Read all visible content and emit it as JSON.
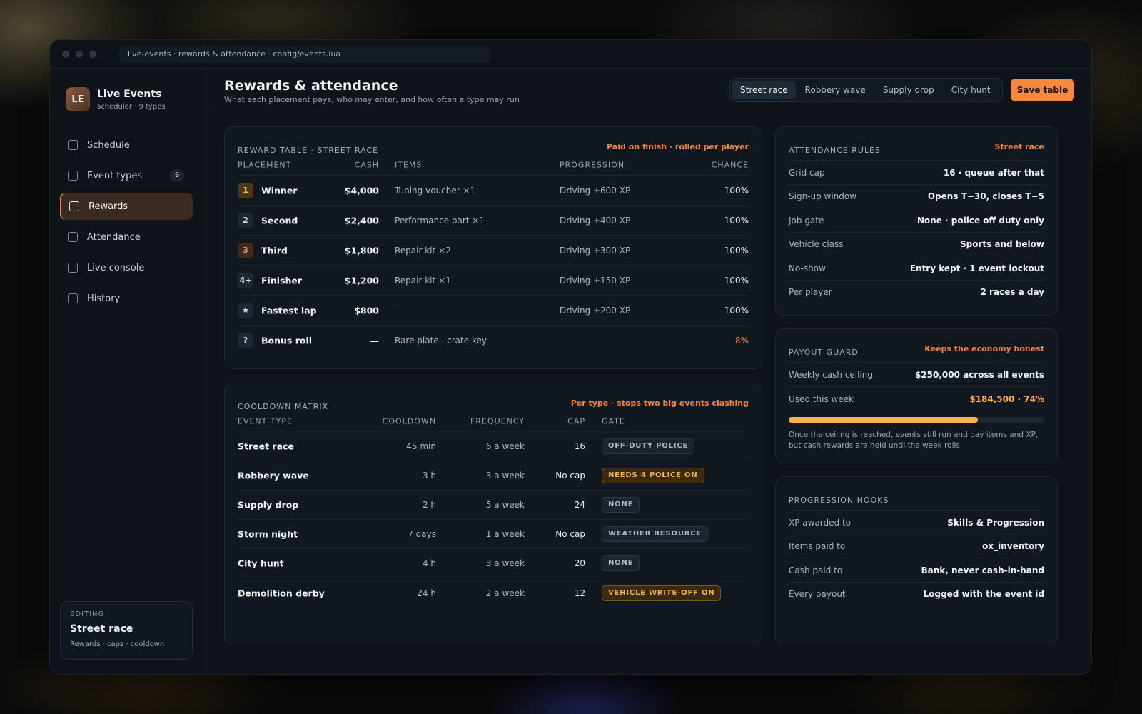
{
  "window": {
    "url": "live-events · rewards & attendance · config/events.lua"
  },
  "sidebar": {
    "brand_initials": "LE",
    "brand_name": "Live Events",
    "brand_sub": "scheduler · 9 types",
    "items": [
      {
        "label": "Schedule"
      },
      {
        "label": "Event types",
        "count": "9"
      },
      {
        "label": "Rewards"
      },
      {
        "label": "Attendance"
      },
      {
        "label": "Live console"
      },
      {
        "label": "History"
      }
    ],
    "editing": {
      "kicker": "EDITING",
      "value": "Street race",
      "sub": "Rewards · caps · cooldown"
    }
  },
  "header": {
    "title": "Rewards & attendance",
    "subtitle": "What each placement pays, who may enter, and how often a type may run",
    "tabs": [
      "Street race",
      "Robbery wave",
      "Supply drop",
      "City hunt"
    ],
    "save_label": "Save table"
  },
  "reward_table": {
    "title": "REWARD TABLE · STREET RACE",
    "note": "Paid on finish · rolled per player",
    "columns": [
      "PLACEMENT",
      "CASH",
      "ITEMS",
      "PROGRESSION",
      "CHANCE"
    ],
    "rows": [
      {
        "badge": "1",
        "placement": "Winner",
        "cash": "$4,000",
        "items": "Tuning voucher ×1",
        "progression": "Driving +600 XP",
        "chance": "100%"
      },
      {
        "badge": "2",
        "placement": "Second",
        "cash": "$2,400",
        "items": "Performance part ×1",
        "progression": "Driving +400 XP",
        "chance": "100%"
      },
      {
        "badge": "3",
        "placement": "Third",
        "cash": "$1,800",
        "items": "Repair kit ×2",
        "progression": "Driving +300 XP",
        "chance": "100%"
      },
      {
        "badge": "4+",
        "placement": "Finisher",
        "cash": "$1,200",
        "items": "Repair kit ×1",
        "progression": "Driving +150 XP",
        "chance": "100%"
      },
      {
        "badge": "★",
        "placement": "Fastest lap",
        "cash": "$800",
        "items": "—",
        "progression": "Driving +200 XP",
        "chance": "100%"
      },
      {
        "badge": "?",
        "placement": "Bonus roll",
        "cash": "—",
        "items": "Rare plate · crate key",
        "progression": "—",
        "chance": "8%"
      }
    ]
  },
  "cooldown_matrix": {
    "title": "COOLDOWN MATRIX",
    "note": "Per type · stops two big events clashing",
    "columns": [
      "EVENT TYPE",
      "COOLDOWN",
      "FREQUENCY",
      "CAP",
      "GATE"
    ],
    "rows": [
      {
        "type": "Street race",
        "cooldown": "45 min",
        "frequency": "6 a week",
        "cap": "16",
        "gate": "OFF-DUTY POLICE"
      },
      {
        "type": "Robbery wave",
        "cooldown": "3 h",
        "frequency": "3 a week",
        "cap": "No cap",
        "gate": "NEEDS 4 POLICE ON"
      },
      {
        "type": "Supply drop",
        "cooldown": "2 h",
        "frequency": "5 a week",
        "cap": "24",
        "gate": "NONE"
      },
      {
        "type": "Storm night",
        "cooldown": "7 days",
        "frequency": "1 a week",
        "cap": "No cap",
        "gate": "WEATHER RESOURCE"
      },
      {
        "type": "City hunt",
        "cooldown": "4 h",
        "frequency": "3 a week",
        "cap": "20",
        "gate": "NONE"
      },
      {
        "type": "Demolition derby",
        "cooldown": "24 h",
        "frequency": "2 a week",
        "cap": "12",
        "gate": "VEHICLE WRITE-OFF ON"
      }
    ]
  },
  "attendance": {
    "title": "ATTENDANCE RULES",
    "note": "Street race",
    "rows": [
      {
        "k": "Grid cap",
        "v": "16 · queue after that"
      },
      {
        "k": "Sign-up window",
        "v": "Opens T−30, closes T−5"
      },
      {
        "k": "Job gate",
        "v": "None · police off duty only"
      },
      {
        "k": "Vehicle class",
        "v": "Sports and below"
      },
      {
        "k": "No-show",
        "v": "Entry kept · 1 event lockout"
      },
      {
        "k": "Per player",
        "v": "2 races a day"
      }
    ]
  },
  "payout_guard": {
    "title": "PAYOUT GUARD",
    "note": "Keeps the economy honest",
    "rows": [
      {
        "k": "Weekly cash ceiling",
        "v": "$250,000 across all events"
      },
      {
        "k": "Used this week",
        "v": "$184,500 · 74%"
      }
    ],
    "used_fraction": 0.74,
    "explanation": "Once the ceiling is reached, events still run and pay items and XP, but cash rewards are held until the week rolls."
  },
  "progression_hooks": {
    "title": "PROGRESSION HOOKS",
    "rows": [
      {
        "k": "XP awarded to",
        "v": "Skills & Progression"
      },
      {
        "k": "Items paid to",
        "v": "ox_inventory"
      },
      {
        "k": "Cash paid to",
        "v": "Bank, never cash-in-hand"
      },
      {
        "k": "Every payout",
        "v": "Logged with the event id"
      }
    ]
  },
  "colors": {
    "accent": "#f58a3e",
    "bar": "#f6b04a",
    "warn_gate": "#f3b24f"
  }
}
